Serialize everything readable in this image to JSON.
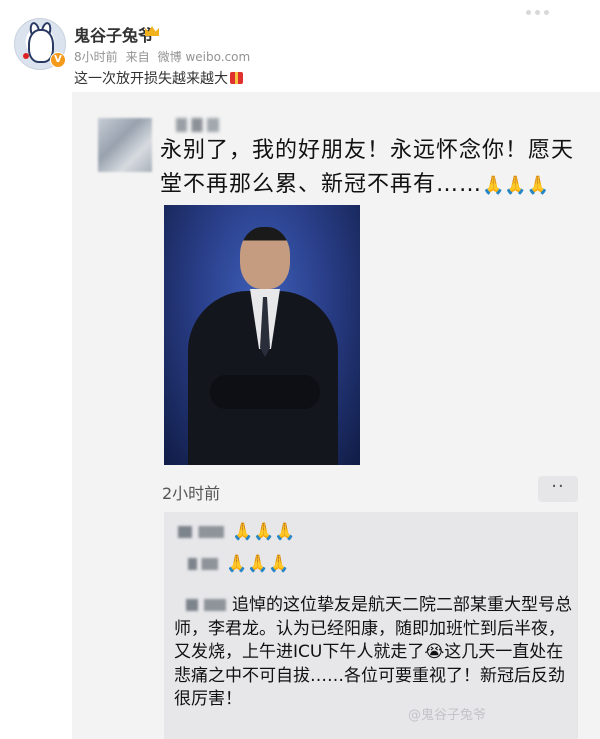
{
  "header": {
    "username": "鬼谷子兔爷",
    "time": "8小时前",
    "source_prefix": "来自",
    "source_name": "微博 weibo.com",
    "text": "这一次放开损失越来越大",
    "badge": "V"
  },
  "moment": {
    "text": "永别了，我的好朋友！永远怀念你！愿天堂不再那么累、新冠不再有……",
    "emoji": "🙏🙏🙏",
    "timestamp": "2小时前",
    "more_label": "··"
  },
  "comments": {
    "row1_emoji": "🙏🙏🙏",
    "row2_emoji": "🙏🙏🙏",
    "text": "追悼的这位挚友是航天二院二部某重大型号总师，李君龙。认为已经阳康，随即加班忙到后半夜，又发烧，上午进ICU下午人就走了😭这几天一直处在悲痛之中不可自拔……各位可要重视了！新冠后反劲很厉害！"
  },
  "watermark": "@鬼谷子兔爷"
}
